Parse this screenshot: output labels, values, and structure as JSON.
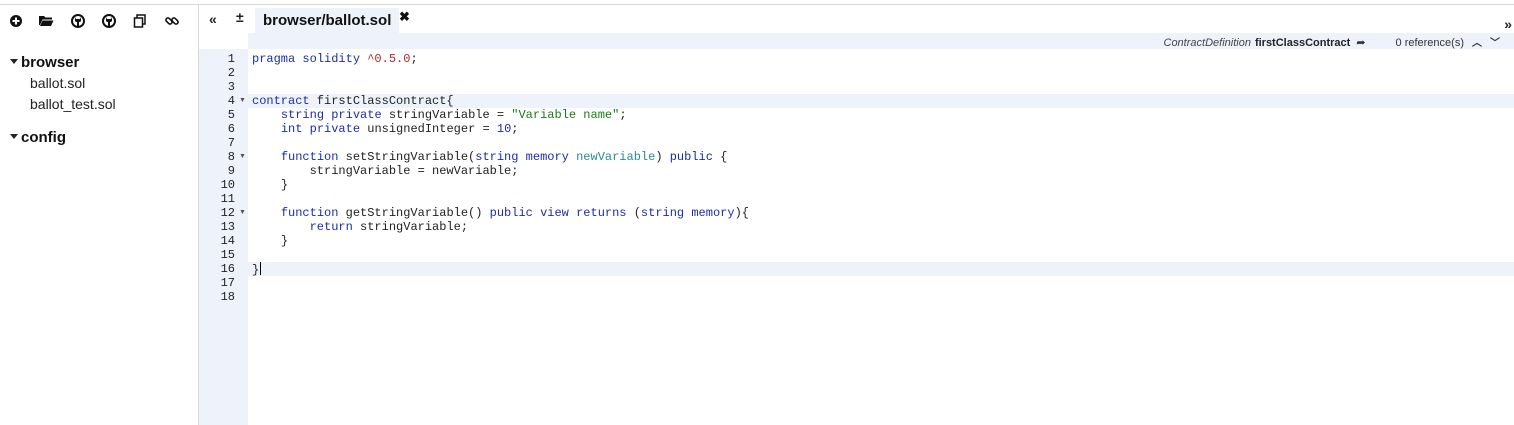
{
  "sidebar": {
    "toolbar_icons": [
      "new-file-icon",
      "open-folder-icon",
      "github-icon",
      "github-gist-icon",
      "copy-icon",
      "link-icon"
    ],
    "folders": [
      {
        "name": "browser",
        "files": [
          "ballot.sol",
          "ballot_test.sol"
        ]
      },
      {
        "name": "config",
        "files": []
      }
    ]
  },
  "tabs": {
    "collapse_icon": "«",
    "zoom_icon": "±",
    "expand_icon": "»",
    "active_tab": "browser/ballot.sol",
    "close_icon": "✖"
  },
  "context": {
    "type_label": "ContractDefinition",
    "name": "firstClassContract",
    "references": "0 reference(s)"
  },
  "editor": {
    "line_numbers": [
      "1",
      "2",
      "3",
      "4",
      "5",
      "6",
      "7",
      "8",
      "9",
      "10",
      "11",
      "12",
      "13",
      "14",
      "15",
      "16",
      "17",
      "18"
    ],
    "code": {
      "l1_pragma": "pragma",
      "l1_solidity": "solidity",
      "l1_version": "^0.5.0",
      "l1_semi": ";",
      "l4_contract": "contract",
      "l4_name": " firstClassContract{",
      "l5_type": "string",
      "l5_private": "private",
      "l5_var": " stringVariable = ",
      "l5_str": "\"Variable name\"",
      "l5_end": ";",
      "l6_type": "int",
      "l6_private": "private",
      "l6_var": " unsignedInteger = ",
      "l6_num": "10",
      "l6_end": ";",
      "l8_function": "function",
      "l8_name": " setStringVariable(",
      "l8_string": "string",
      "l8_memory": "memory",
      "l8_param": "newVariable",
      "l8_close": ") ",
      "l8_public": "public",
      "l8_brace": " {",
      "l9_body": "stringVariable = newVariable;",
      "l10_brace": "}",
      "l12_function": "function",
      "l12_name": " getStringVariable() ",
      "l12_public": "public",
      "l12_view": "view",
      "l12_returns": "returns",
      "l12_open": " (",
      "l12_string": "string",
      "l12_memory": "memory",
      "l12_close": "){",
      "l13_return": "return",
      "l13_body": " stringVariable;",
      "l14_brace": "}",
      "l16_brace": "}"
    }
  }
}
